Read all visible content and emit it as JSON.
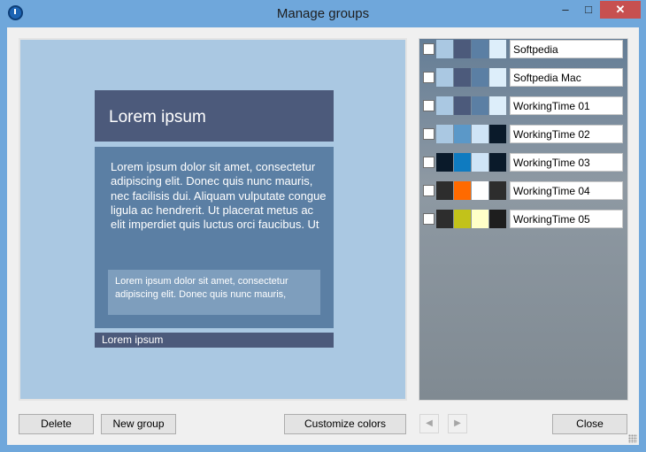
{
  "window": {
    "title": "Manage groups",
    "minimize_glyph": "–",
    "maximize_glyph": "□",
    "close_glyph": "✕",
    "icon": "app-clock-icon"
  },
  "preview": {
    "heading": "Lorem ipsum",
    "body": "Lorem ipsum dolor sit amet, consectetur adipiscing elit. Donec quis nunc mauris, nec facilisis dui. Aliquam vulputate congue ligula ac hendrerit. Ut placerat metus ac elit imperdiet quis luctus orci faucibus. Ut",
    "inner": "Lorem ipsum dolor sit amet, consectetur adipiscing elit. Donec quis nunc mauris,",
    "footer": "Lorem ipsum",
    "colors": {
      "background": "#aac8e2",
      "heading": "#4c5a7b",
      "body": "#5b7fa4",
      "inner": "#7e9ebd",
      "footer": "#4c5a7b"
    }
  },
  "groups": [
    {
      "name": "Softpedia",
      "checked": false,
      "colors": [
        "#aac8e2",
        "#4c5a7b",
        "#5b7fa4",
        "#ddeefa"
      ]
    },
    {
      "name": "Softpedia Mac",
      "checked": false,
      "colors": [
        "#aac8e2",
        "#4c5a7b",
        "#5b7fa4",
        "#ddeefa"
      ]
    },
    {
      "name": "WorkingTime 01",
      "checked": false,
      "colors": [
        "#aac8e2",
        "#4c5a7b",
        "#5b7fa4",
        "#ddeefa"
      ]
    },
    {
      "name": "WorkingTime 02",
      "checked": false,
      "colors": [
        "#aac8e2",
        "#5b98c8",
        "#cfe4f6",
        "#0a1a2a"
      ]
    },
    {
      "name": "WorkingTime 03",
      "checked": false,
      "colors": [
        "#0a1a2a",
        "#0f7bc0",
        "#cfe4f6",
        "#0a1a2a"
      ]
    },
    {
      "name": "WorkingTime 04",
      "checked": false,
      "colors": [
        "#2d2d2d",
        "#ff6a00",
        "#ffffff",
        "#2d2d2d"
      ]
    },
    {
      "name": "WorkingTime 05",
      "checked": false,
      "colors": [
        "#2d2d2d",
        "#c2c21a",
        "#ffffc8",
        "#1e1e1e"
      ]
    }
  ],
  "buttons": {
    "delete": "Delete",
    "new_group": "New group",
    "customize_colors": "Customize colors",
    "prev": "◀",
    "next": "▶",
    "close": "Close"
  },
  "icons": {
    "prev": "triangle-left-icon",
    "next": "triangle-right-icon",
    "grip": "resize-grip-icon"
  }
}
